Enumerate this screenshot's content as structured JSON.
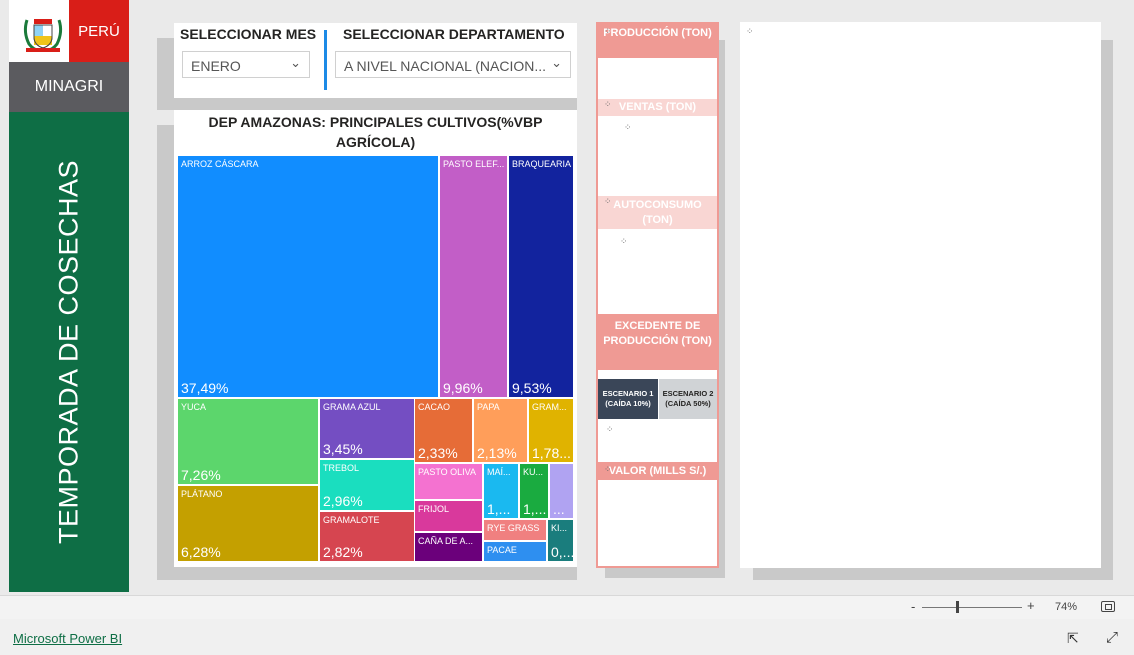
{
  "brand": {
    "country": "PERÚ",
    "ministry": "MINAGRI",
    "title": "TEMPORADA DE COSECHAS"
  },
  "slicers": {
    "month_label": "SELECCIONAR MES",
    "month_value": "ENERO",
    "dept_label": "SELECCIONAR DEPARTAMENTO",
    "dept_value": "A NIVEL NACIONAL (NACION..."
  },
  "treemap": {
    "title": "DEP AMAZONAS: PRINCIPALES CULTIVOS(%VBP AGRÍCOLA)",
    "tiles": [
      {
        "name": "ARROZ CÁSCARA",
        "pct": "37,49%",
        "color": "#118dff"
      },
      {
        "name": "PASTO ELEF...",
        "pct": "9,96%",
        "color": "#c25ec7"
      },
      {
        "name": "BRAQUEARIA",
        "pct": "9,53%",
        "color": "#12239e"
      },
      {
        "name": "YUCA",
        "pct": "7,26%",
        "color": "#5cd66c"
      },
      {
        "name": "PLÁTANO",
        "pct": "6,28%",
        "color": "#c4a000"
      },
      {
        "name": "GRAMA AZUL",
        "pct": "3,45%",
        "color": "#744ec2"
      },
      {
        "name": "TREBOL",
        "pct": "2,96%",
        "color": "#1adebf"
      },
      {
        "name": "GRAMALOTE",
        "pct": "2,82%",
        "color": "#d64550"
      },
      {
        "name": "CACAO",
        "pct": "2,33%",
        "color": "#e66c37"
      },
      {
        "name": "PAPA",
        "pct": "2,13%",
        "color": "#ff9e5a"
      },
      {
        "name": "GRAM...",
        "pct": "1,78...",
        "color": "#e0b300"
      },
      {
        "name": "PASTO OLIVA",
        "pct": "",
        "color": "#f472d0"
      },
      {
        "name": "FRIJOL",
        "pct": "",
        "color": "#d9399c"
      },
      {
        "name": "CAÑA DE A...",
        "pct": "",
        "color": "#6b007b"
      },
      {
        "name": "MAÍ...",
        "pct": "1,...",
        "color": "#1ab9f0"
      },
      {
        "name": "KU...",
        "pct": "1,...",
        "color": "#1aab40"
      },
      {
        "name": "",
        "pct": "...",
        "color": "#b0a3f2"
      },
      {
        "name": "RYE GRASS",
        "pct": "",
        "color": "#f08080"
      },
      {
        "name": "PACAE",
        "pct": "",
        "color": "#2e8ff0"
      },
      {
        "name": "KI...",
        "pct": "0,...",
        "color": "#1a7d7d"
      }
    ]
  },
  "kpis": {
    "produccion": "PRODUCCIÓN (TON)",
    "ventas": "VENTAS (TON)",
    "autoconsumo": "AUTOCONSUMO (TON)",
    "excedente": "EXCEDENTE DE PRODUCCIÓN (TON)",
    "escenario1": "ESCENARIO 1 (CAÍDA 10%)",
    "escenario2": "ESCENARIO 2 (CAÍDA 50%)",
    "valor": "VALOR (MILLS S/.)"
  },
  "zoom": {
    "minus": "-",
    "plus": "+",
    "level": "74%",
    "level_fraction": 0.74
  },
  "footer": {
    "link": "Microsoft Power BI"
  },
  "colors": {
    "brand_red": "#d91e18",
    "brand_green": "#0e6e45",
    "brand_gray": "#5b5b5f",
    "kpi_header": "#ef9a94",
    "kpi_header_light": "#f9d6d3",
    "accent_blue": "#1c8ae6"
  }
}
